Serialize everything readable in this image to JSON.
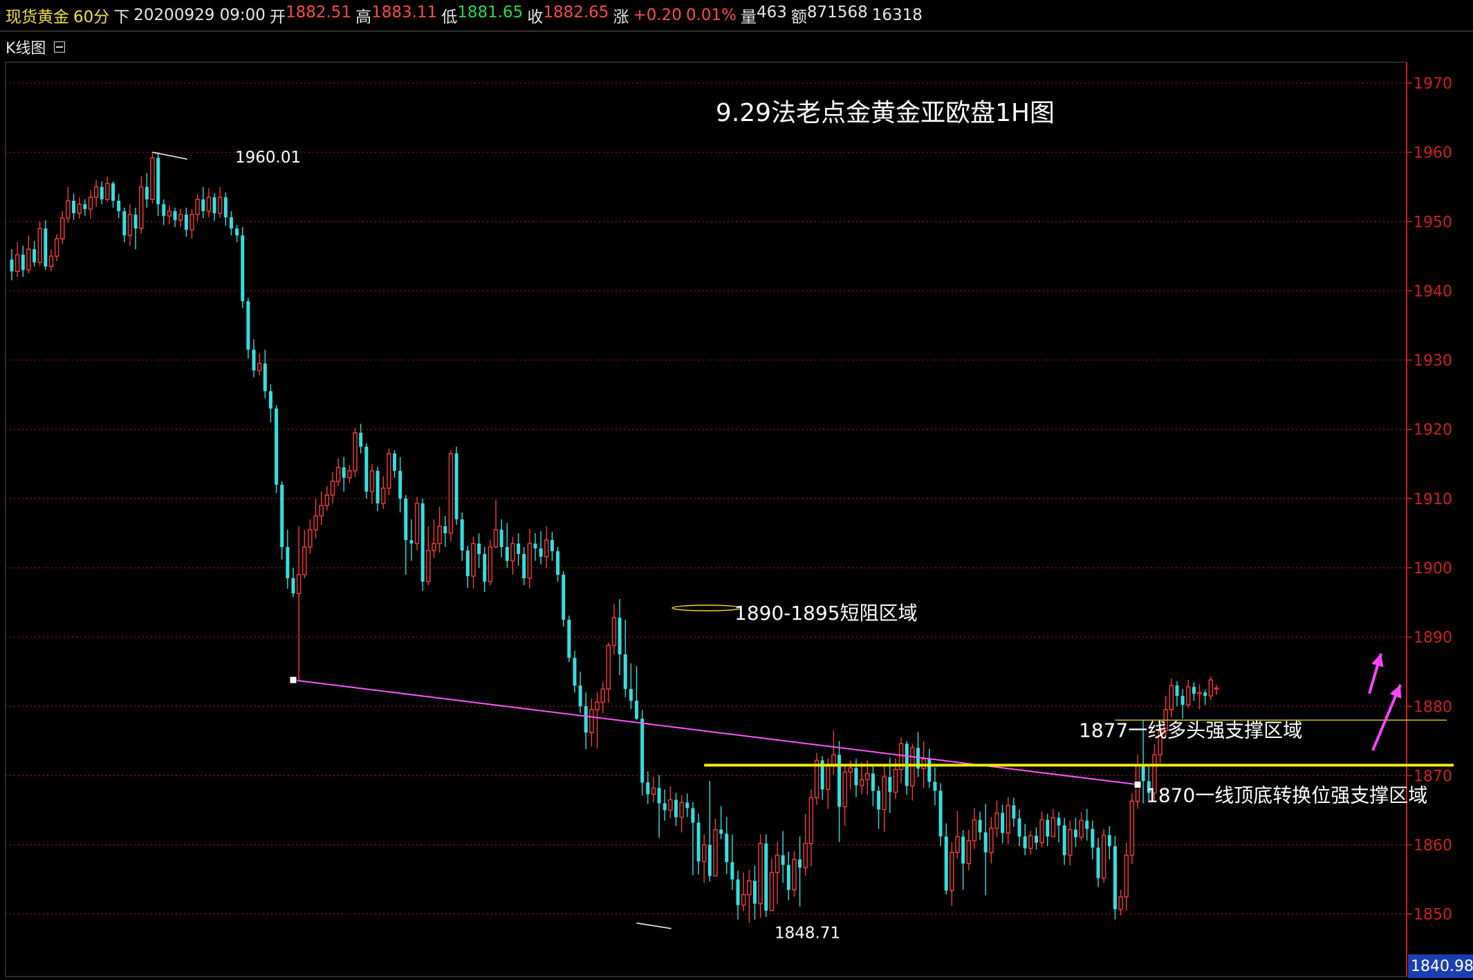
{
  "header": {
    "instrument": "现货黄金",
    "period": "60分",
    "direction": "下",
    "datetime": "20200929 09:00",
    "open_label": "开",
    "open": "1882.51",
    "high_label": "高",
    "high": "1883.11",
    "low_label": "低",
    "low": "1881.65",
    "close_label": "收",
    "close": "1882.65",
    "change_label": "涨",
    "change": "+0.20",
    "change_pct": "0.01%",
    "volume_label": "量",
    "volume": "463",
    "amount_label": "额",
    "amount": "871568",
    "extra": "16318"
  },
  "panel": {
    "title": "K线图"
  },
  "current_price": "1840.98",
  "colors": {
    "up": "#ff3b3b",
    "down": "#33e0e0",
    "trendline": "#ff55ff",
    "support": "#f0f000",
    "axis": "#d02020"
  },
  "chart_data": {
    "type": "candlestick",
    "title": "9.29法老点金黄金亚欧盘1H图",
    "ylim": [
      1840.98,
      1973
    ],
    "yticks": [
      1970,
      1960,
      1950,
      1940,
      1930,
      1920,
      1910,
      1900,
      1890,
      1880,
      1870,
      1860,
      1850
    ],
    "grid": true,
    "annotations": [
      {
        "text": "1960.01",
        "price": 1960.01
      },
      {
        "text": "1848.71",
        "price": 1848.71
      },
      {
        "text": "1890-1895短阻区域",
        "price": 1895
      },
      {
        "text": "1877一线多头强支撑区域",
        "price": 1877
      },
      {
        "text": "1870一线顶底转换位强支撑区域",
        "price": 1870
      }
    ],
    "trendline": {
      "start_index": 50,
      "start_price": 1883.8,
      "end_index": 200,
      "end_price": 1868.7
    },
    "support_levels": [
      1871.5,
      1878
    ],
    "candles": [
      [
        1944.5,
        1942.8,
        1946,
        1941.5
      ],
      [
        1942.8,
        1945.2,
        1947,
        1942
      ],
      [
        1945.2,
        1943,
        1946.5,
        1942
      ],
      [
        1943,
        1946,
        1948,
        1942.5
      ],
      [
        1946,
        1944.1,
        1947.2,
        1943.5
      ],
      [
        1944.1,
        1949,
        1950,
        1943.6
      ],
      [
        1949,
        1943.5,
        1950.2,
        1943
      ],
      [
        1943.5,
        1945,
        1946,
        1942.8
      ],
      [
        1945,
        1947.5,
        1948.2,
        1944.3
      ],
      [
        1947.5,
        1950.5,
        1951.5,
        1946.8
      ],
      [
        1950.5,
        1953,
        1955,
        1949.8
      ],
      [
        1953,
        1951.2,
        1954,
        1950.2
      ],
      [
        1951.2,
        1952.5,
        1953.5,
        1950.4
      ],
      [
        1952.5,
        1951.8,
        1953.2,
        1950.8
      ],
      [
        1951.8,
        1953.5,
        1954.5,
        1950.4
      ],
      [
        1953.5,
        1955,
        1956,
        1952.1
      ],
      [
        1955,
        1953.2,
        1955.8,
        1952.5
      ],
      [
        1953.2,
        1955.5,
        1956.5,
        1952.8
      ],
      [
        1955.5,
        1953,
        1955.8,
        1952
      ],
      [
        1953,
        1951.5,
        1954,
        1950.5
      ],
      [
        1951.5,
        1948,
        1952,
        1947
      ],
      [
        1948,
        1951,
        1952.5,
        1946.5
      ],
      [
        1951,
        1949,
        1952,
        1946
      ],
      [
        1949,
        1955,
        1956.5,
        1948.2
      ],
      [
        1955,
        1953.2,
        1957,
        1952
      ],
      [
        1953.2,
        1959.2,
        1960.01,
        1952.6
      ],
      [
        1959.2,
        1952.5,
        1960,
        1950.8
      ],
      [
        1952.5,
        1950.8,
        1953.2,
        1949.5
      ],
      [
        1950.8,
        1951.5,
        1952.3,
        1949.6
      ],
      [
        1951.5,
        1950.2,
        1952,
        1949.2
      ],
      [
        1950.2,
        1951,
        1951.8,
        1949.2
      ],
      [
        1951,
        1948.8,
        1952,
        1947.8
      ],
      [
        1948.8,
        1951,
        1951.8,
        1947.5
      ],
      [
        1951,
        1953.2,
        1954,
        1950
      ],
      [
        1953.2,
        1951.5,
        1955,
        1950.5
      ],
      [
        1951.5,
        1953.5,
        1954.8,
        1950.6
      ],
      [
        1953.5,
        1951.2,
        1954.1,
        1950.1
      ],
      [
        1951.2,
        1953.5,
        1955,
        1950.5
      ],
      [
        1953.5,
        1950.6,
        1954.2,
        1949.4
      ],
      [
        1950.6,
        1949,
        1951.5,
        1948
      ],
      [
        1949,
        1948,
        1949.5,
        1947
      ],
      [
        1948,
        1938.5,
        1949.2,
        1937.5
      ],
      [
        1938.5,
        1931.5,
        1939,
        1930.2
      ],
      [
        1931.5,
        1928.5,
        1933,
        1927.5
      ],
      [
        1928.5,
        1929.5,
        1931,
        1927.8
      ],
      [
        1929.5,
        1925.5,
        1931.5,
        1924.5
      ],
      [
        1925.5,
        1923,
        1926.5,
        1921
      ],
      [
        1923,
        1912,
        1923.5,
        1910.8
      ],
      [
        1912,
        1903,
        1912.5,
        1901.2
      ],
      [
        1903,
        1898.5,
        1905.5,
        1897
      ],
      [
        1898.5,
        1896.3,
        1900,
        1895.8
      ],
      [
        1896.3,
        1899,
        1906,
        1883.6
      ],
      [
        1899,
        1903,
        1905.5,
        1898.5
      ],
      [
        1903,
        1905.5,
        1907,
        1902
      ],
      [
        1905.5,
        1907.5,
        1910,
        1904.2
      ],
      [
        1907.5,
        1909,
        1911,
        1906.2
      ],
      [
        1909,
        1910.5,
        1911.8,
        1908.3
      ],
      [
        1910.5,
        1912.5,
        1913.8,
        1909.3
      ],
      [
        1912.5,
        1914.5,
        1915.8,
        1911.8
      ],
      [
        1914.5,
        1913,
        1916,
        1911
      ],
      [
        1913,
        1914,
        1914.8,
        1912.2
      ],
      [
        1914,
        1919.5,
        1920.2,
        1913.1
      ],
      [
        1919.5,
        1917.5,
        1920.8,
        1916.5
      ],
      [
        1917.5,
        1911,
        1918,
        1910
      ],
      [
        1911,
        1914,
        1915,
        1909.2
      ],
      [
        1914,
        1909.3,
        1914.6,
        1908.2
      ],
      [
        1909.3,
        1911.5,
        1913.2,
        1908.5
      ],
      [
        1911.5,
        1916.5,
        1917.2,
        1910.5
      ],
      [
        1916.5,
        1914,
        1917,
        1913
      ],
      [
        1914,
        1910,
        1916,
        1908
      ],
      [
        1910,
        1904,
        1910.5,
        1899
      ],
      [
        1904,
        1903.5,
        1907,
        1901
      ],
      [
        1903.5,
        1909.3,
        1910.2,
        1902.5
      ],
      [
        1909.3,
        1898,
        1910,
        1896.7
      ],
      [
        1898,
        1902.5,
        1906,
        1897.5
      ],
      [
        1902.5,
        1903.5,
        1907,
        1901.4
      ],
      [
        1903.5,
        1906,
        1908.8,
        1902.2
      ],
      [
        1906,
        1905,
        1907.5,
        1903
      ],
      [
        1905,
        1916.5,
        1917,
        1903.8
      ],
      [
        1916.5,
        1907,
        1917.5,
        1906.2
      ],
      [
        1907,
        1902.5,
        1908,
        1901
      ],
      [
        1902.5,
        1898.8,
        1903.2,
        1897.1
      ],
      [
        1898.8,
        1903.5,
        1904.5,
        1897
      ],
      [
        1903.5,
        1902,
        1905,
        1900
      ],
      [
        1902,
        1898,
        1903,
        1896.5
      ],
      [
        1898,
        1903,
        1904,
        1897.5
      ],
      [
        1903,
        1905.5,
        1909.8,
        1902.8
      ],
      [
        1905.5,
        1903,
        1907,
        1901.5
      ],
      [
        1903,
        1901,
        1906.5,
        1900
      ],
      [
        1901,
        1903.5,
        1904.5,
        1899
      ],
      [
        1903.5,
        1902,
        1905,
        1900.3
      ],
      [
        1902,
        1898.5,
        1903,
        1897.5
      ],
      [
        1898.5,
        1903.5,
        1905.6,
        1897
      ],
      [
        1903.5,
        1902.8,
        1905,
        1901
      ],
      [
        1902.8,
        1901.6,
        1905.3,
        1900.5
      ],
      [
        1901.6,
        1904,
        1906,
        1900
      ],
      [
        1904,
        1902.4,
        1905.2,
        1901
      ],
      [
        1902.4,
        1899,
        1903,
        1898
      ],
      [
        1899,
        1892.5,
        1899.5,
        1891.5
      ],
      [
        1892.5,
        1887,
        1893.1,
        1886.4
      ],
      [
        1887,
        1883,
        1888,
        1882
      ],
      [
        1883,
        1880,
        1885,
        1879
      ],
      [
        1880,
        1876.2,
        1882,
        1873.8
      ],
      [
        1876.2,
        1879.5,
        1881.1,
        1874.2
      ],
      [
        1879.5,
        1880.6,
        1882,
        1873.9
      ],
      [
        1880.6,
        1882.5,
        1883.5,
        1879
      ],
      [
        1882.5,
        1888.8,
        1889.2,
        1880.5
      ],
      [
        1888.8,
        1892.8,
        1894.8,
        1887.5
      ],
      [
        1892.8,
        1887.5,
        1895.5,
        1884.5
      ],
      [
        1887.5,
        1882.5,
        1892.5,
        1881.3
      ],
      [
        1882.5,
        1880.8,
        1886.2,
        1879.6
      ],
      [
        1880.8,
        1878.2,
        1885.8,
        1878
      ],
      [
        1878.2,
        1869,
        1879.5,
        1867.1
      ],
      [
        1869,
        1867.3,
        1870.6,
        1865.9
      ],
      [
        1867.3,
        1868.2,
        1869.8,
        1866.1
      ],
      [
        1868.2,
        1866,
        1870.1,
        1861
      ],
      [
        1866,
        1865,
        1868,
        1863.5
      ],
      [
        1865,
        1866.5,
        1868.5,
        1863.8
      ],
      [
        1866.5,
        1864,
        1867.5,
        1862.7
      ],
      [
        1864,
        1866.1,
        1867.2,
        1861.8
      ],
      [
        1866.1,
        1865.3,
        1867.4,
        1864
      ],
      [
        1865.3,
        1863.2,
        1866.2,
        1855.6
      ],
      [
        1863.2,
        1857.6,
        1864.5,
        1855.7
      ],
      [
        1857.6,
        1860,
        1861.5,
        1854.5
      ],
      [
        1860,
        1855.5,
        1869.2,
        1854.7
      ],
      [
        1855.5,
        1862.2,
        1863.8,
        1855.6
      ],
      [
        1862.2,
        1861.6,
        1865.6,
        1860.8
      ],
      [
        1861.6,
        1857.5,
        1864,
        1855.8
      ],
      [
        1857.5,
        1855,
        1861.5,
        1853.5
      ],
      [
        1855,
        1851.3,
        1856.3,
        1849.2
      ],
      [
        1851.3,
        1852.8,
        1856,
        1850.4
      ],
      [
        1852.8,
        1854.8,
        1856.4,
        1848.71
      ],
      [
        1854.8,
        1851.5,
        1857,
        1849.2
      ],
      [
        1851.5,
        1860.2,
        1861.5,
        1849.5
      ],
      [
        1860.2,
        1850.5,
        1861.5,
        1849.6
      ],
      [
        1850.5,
        1856,
        1858,
        1850.8
      ],
      [
        1856,
        1858.5,
        1860.4,
        1851.4
      ],
      [
        1858.5,
        1857.1,
        1862,
        1854.5
      ],
      [
        1857.1,
        1853.5,
        1859,
        1852
      ],
      [
        1853.5,
        1857.9,
        1859.1,
        1852.5
      ],
      [
        1857.9,
        1856.7,
        1861.2,
        1851.1
      ],
      [
        1856.7,
        1860.2,
        1864.5,
        1855.5
      ],
      [
        1860.2,
        1866.8,
        1868,
        1856.9
      ],
      [
        1866.8,
        1872.2,
        1873.3,
        1865.8
      ],
      [
        1872.2,
        1868,
        1872.8,
        1866.5
      ],
      [
        1868,
        1871.5,
        1872.5,
        1865.2
      ],
      [
        1871.5,
        1873,
        1876.5,
        1870.1
      ],
      [
        1873,
        1865.5,
        1875,
        1860.4
      ],
      [
        1865.5,
        1870.5,
        1871.5,
        1862.8
      ],
      [
        1870.5,
        1871.1,
        1872.2,
        1868
      ],
      [
        1871.1,
        1868.6,
        1872.4,
        1866.9
      ],
      [
        1868.6,
        1869.4,
        1871.9,
        1867.3
      ],
      [
        1869.4,
        1870.3,
        1872.2,
        1867.2
      ],
      [
        1870.3,
        1867.8,
        1871.3,
        1865.6
      ],
      [
        1867.8,
        1865.1,
        1868.5,
        1862.3
      ],
      [
        1865.1,
        1869.8,
        1871.6,
        1861.9
      ],
      [
        1869.8,
        1867.6,
        1872.6,
        1864.6
      ],
      [
        1867.6,
        1870.9,
        1872.5,
        1866.6
      ],
      [
        1870.9,
        1874.6,
        1875.5,
        1868.9
      ],
      [
        1874.6,
        1868.5,
        1875,
        1867.2
      ],
      [
        1868.5,
        1874,
        1874.6,
        1866.4
      ],
      [
        1874,
        1871,
        1876.3,
        1869.8
      ],
      [
        1871,
        1872.4,
        1875,
        1868.2
      ],
      [
        1872.4,
        1869.1,
        1873.9,
        1868.2
      ],
      [
        1869.1,
        1867.8,
        1871.2,
        1865.7
      ],
      [
        1867.8,
        1861.2,
        1868.9,
        1859.8
      ],
      [
        1861.2,
        1853.4,
        1863.1,
        1852.8
      ],
      [
        1853.4,
        1858.9,
        1860.4,
        1851.2
      ],
      [
        1858.9,
        1861.2,
        1864.9,
        1858
      ],
      [
        1861.2,
        1857.3,
        1862.1,
        1853.5
      ],
      [
        1857.3,
        1860.6,
        1862.2,
        1856.3
      ],
      [
        1860.6,
        1863.6,
        1865.3,
        1859.4
      ],
      [
        1863.6,
        1861.8,
        1864.8,
        1860.7
      ],
      [
        1861.8,
        1858.9,
        1865.9,
        1852.7
      ],
      [
        1858.9,
        1862.4,
        1864,
        1857.3
      ],
      [
        1862.4,
        1864.6,
        1866.4,
        1861.1
      ],
      [
        1864.6,
        1861.7,
        1865.8,
        1860.2
      ],
      [
        1861.7,
        1865.7,
        1866.9,
        1860.1
      ],
      [
        1865.7,
        1863.8,
        1866.8,
        1862.6
      ],
      [
        1863.8,
        1861.2,
        1865.1,
        1859.8
      ],
      [
        1861.2,
        1859.5,
        1863,
        1858.5
      ],
      [
        1859.5,
        1861.3,
        1862,
        1858.6
      ],
      [
        1861.3,
        1860.3,
        1862.5,
        1859.3
      ],
      [
        1860.3,
        1863.6,
        1864.8,
        1859.6
      ],
      [
        1863.6,
        1861.2,
        1864.5,
        1859.8
      ],
      [
        1861.2,
        1863.9,
        1865.2,
        1861.5
      ],
      [
        1863.9,
        1862.8,
        1864.7,
        1860.3
      ],
      [
        1862.8,
        1858.5,
        1863.9,
        1857.1
      ],
      [
        1858.5,
        1862.2,
        1863.5,
        1857
      ],
      [
        1862.2,
        1861.1,
        1863.9,
        1859.7
      ],
      [
        1861.1,
        1863.5,
        1864.7,
        1860.6
      ],
      [
        1863.5,
        1862.3,
        1865.2,
        1860.6
      ],
      [
        1862.3,
        1859.6,
        1863.5,
        1857.9
      ],
      [
        1859.6,
        1855.2,
        1861,
        1853.9
      ],
      [
        1855.2,
        1861.4,
        1862.3,
        1854.5
      ],
      [
        1861.4,
        1859.8,
        1862.7,
        1857.9
      ],
      [
        1859.8,
        1850.7,
        1861.3,
        1849.2
      ],
      [
        1850.7,
        1852.5,
        1853.5,
        1849.8
      ],
      [
        1852.5,
        1858.5,
        1860.3,
        1850.5
      ],
      [
        1858.5,
        1866.3,
        1867.5,
        1857.2
      ],
      [
        1866.3,
        1871.5,
        1873,
        1865.2
      ],
      [
        1871.5,
        1869.2,
        1878,
        1866
      ],
      [
        1869.2,
        1867.5,
        1871.3,
        1866.1
      ],
      [
        1867.5,
        1873,
        1874.5,
        1866.5
      ],
      [
        1873,
        1876.5,
        1877.8,
        1871.8
      ],
      [
        1876.5,
        1879.5,
        1881.5,
        1875.5
      ],
      [
        1879.5,
        1883,
        1884,
        1878.4
      ],
      [
        1883,
        1881.5,
        1883.6,
        1880
      ],
      [
        1881.5,
        1880.2,
        1882.5,
        1878.2
      ],
      [
        1880.2,
        1882.8,
        1883.8,
        1879.8
      ],
      [
        1882.8,
        1881.8,
        1883.5,
        1880.8
      ],
      [
        1881.8,
        1882,
        1883.2,
        1879.6
      ],
      [
        1882,
        1881.5,
        1882.4,
        1880.2
      ],
      [
        1881.5,
        1883.8,
        1884.3,
        1880.9
      ],
      [
        1882.51,
        1882.65,
        1883.11,
        1881.65
      ]
    ]
  }
}
